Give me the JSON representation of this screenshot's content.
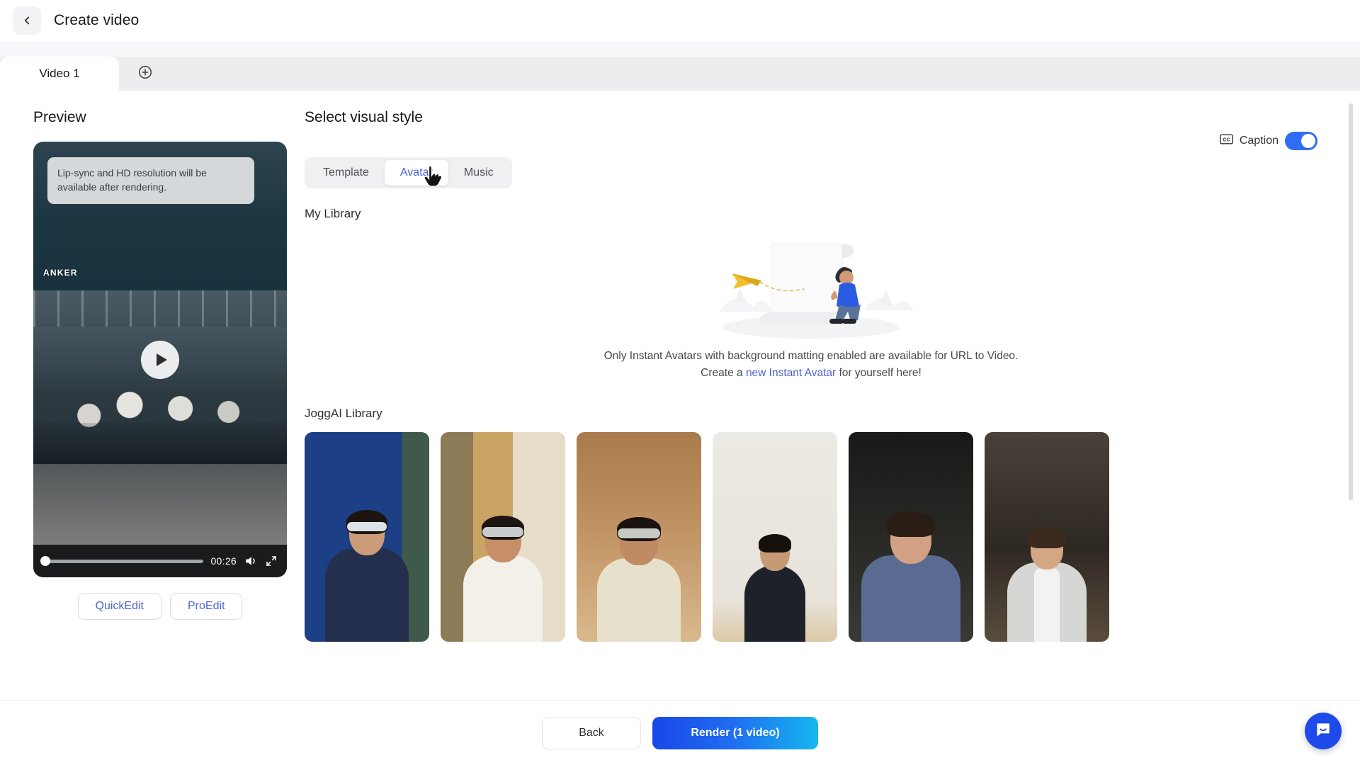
{
  "header": {
    "title": "Create video",
    "back_icon": "chevron-left-icon"
  },
  "tabs": {
    "items": [
      {
        "label": "Video 1",
        "active": true
      }
    ],
    "add_icon": "plus-circle-icon"
  },
  "preview": {
    "heading": "Preview",
    "notice": "Lip-sync and HD resolution will be available after rendering.",
    "brand_watermark": "ANKER",
    "play_icon": "play-icon",
    "duration": "00:26",
    "volume_icon": "volume-icon",
    "fullscreen_icon": "fullscreen-icon",
    "buttons": {
      "quick_edit": "QuickEdit",
      "pro_edit": "ProEdit"
    }
  },
  "main": {
    "heading": "Select visual style",
    "segmented": {
      "options": [
        {
          "label": "Template",
          "active": false
        },
        {
          "label": "Avatar",
          "active": true
        },
        {
          "label": "Music",
          "active": false
        }
      ]
    },
    "caption": {
      "icon": "cc-icon",
      "label": "Caption",
      "enabled": true
    },
    "my_library": {
      "heading": "My Library",
      "empty_line1": "Only Instant Avatars with background matting enabled are available for URL to Video.",
      "empty_prefix": "Create a ",
      "empty_link": "new Instant Avatar",
      "empty_suffix": " for yourself here!",
      "illustration": "empty-state-scroll-illustration"
    },
    "jogg_library": {
      "heading": "JoggAI Library",
      "avatars": [
        {
          "name": "avatar-card-1",
          "bg": "#1d3f85",
          "skin": "#cc9b79",
          "shirt": "#232f4c",
          "hair": "#1b1410",
          "band": "#dbe2e8"
        },
        {
          "name": "avatar-card-2",
          "bg": "#b99355",
          "skin": "#c68f68",
          "shirt": "#f3f0ea",
          "hair": "#1d1511",
          "band": "#c9ccce"
        },
        {
          "name": "avatar-card-3",
          "bg": "#b08352",
          "skin": "#c08a62",
          "shirt": "#e7e0cb",
          "hair": "#19120e",
          "band": "#c6c9c4"
        },
        {
          "name": "avatar-card-4",
          "bg": "#e9e5de",
          "skin": "#c79a76",
          "shirt": "#1d222a",
          "hair": "#16100d",
          "band": ""
        },
        {
          "name": "avatar-card-5",
          "bg": "#232321",
          "skin": "#d2a183",
          "shirt": "#5a6b92",
          "hair": "#2a1d16",
          "band": ""
        },
        {
          "name": "avatar-card-6",
          "bg": "#3b342f",
          "skin": "#d3a684",
          "shirt": "#d6d6d4",
          "hair": "#3b2a1d",
          "band": ""
        }
      ]
    }
  },
  "footer": {
    "back": "Back",
    "render": "Render (1 video)"
  },
  "chat": {
    "icon": "intercom-chat-icon"
  },
  "cursor": {
    "icon": "pointing-hand-cursor"
  },
  "colors": {
    "accent_blue": "#4f63d2",
    "toggle_on": "#2f6df6",
    "render_gradient_start": "#1a47e8",
    "render_gradient_end": "#17b6ef"
  }
}
